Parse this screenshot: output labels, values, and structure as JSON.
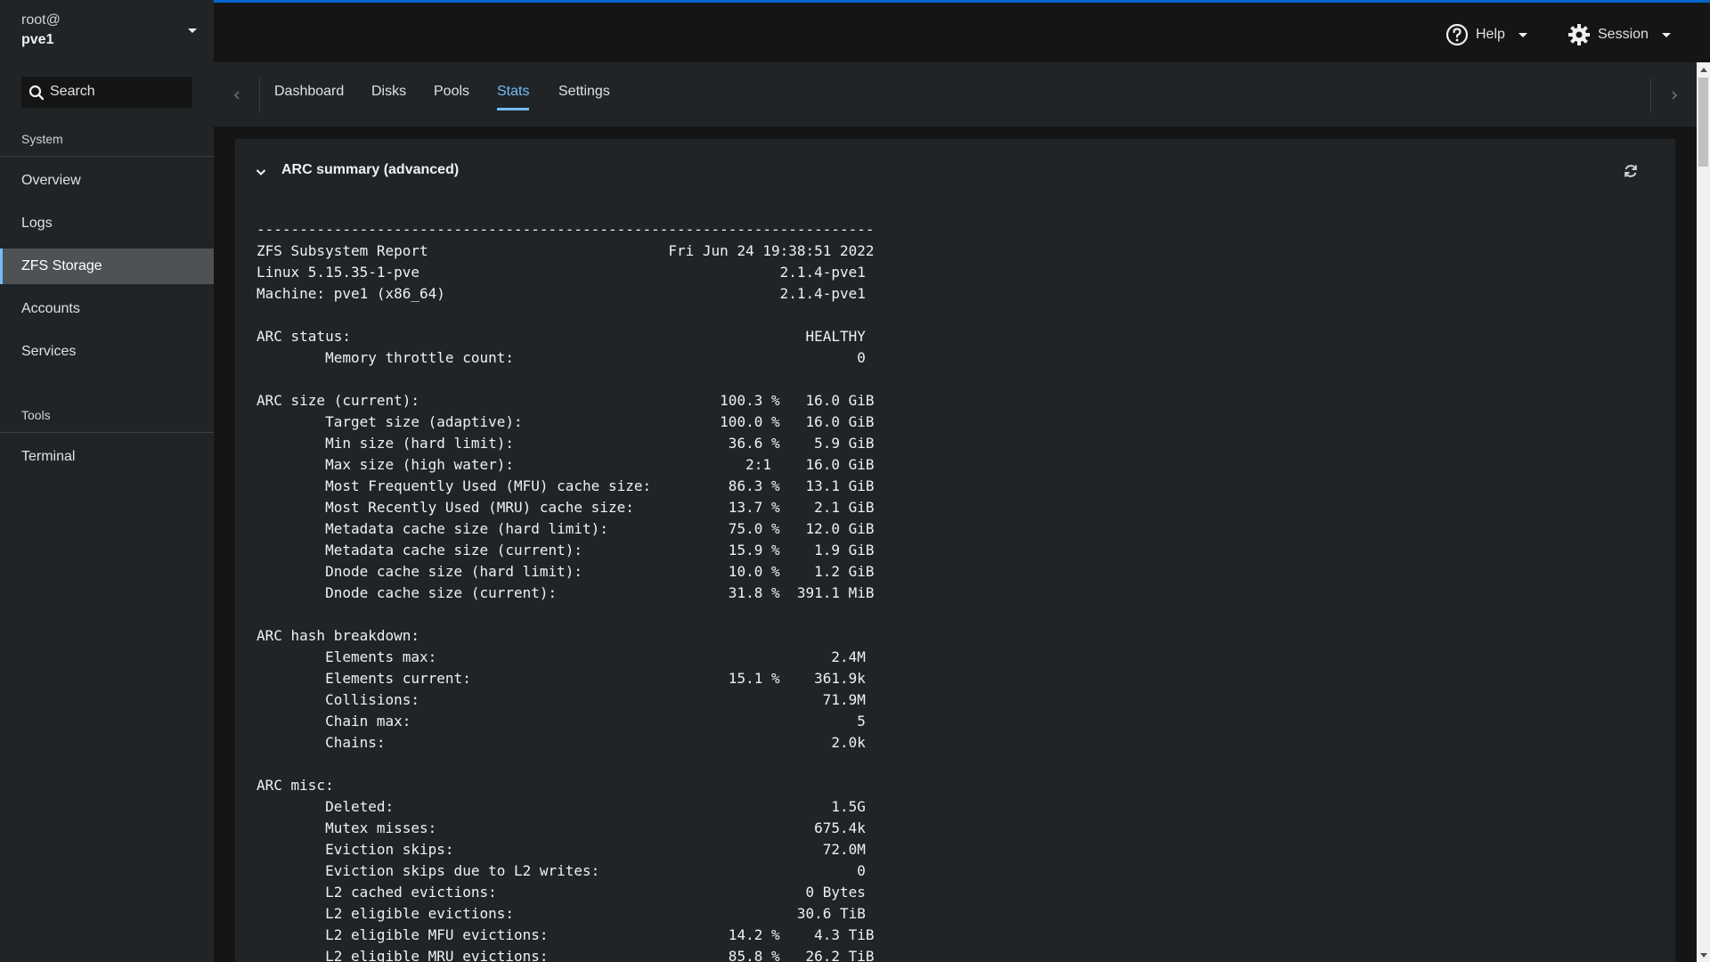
{
  "host": {
    "user": "root@",
    "name": "pve1"
  },
  "search": {
    "label": "Search"
  },
  "sidebar": {
    "system_label": "System",
    "tools_label": "Tools",
    "items": [
      {
        "label": "Overview"
      },
      {
        "label": "Logs"
      },
      {
        "label": "ZFS Storage",
        "active": true
      },
      {
        "label": "Accounts"
      },
      {
        "label": "Services"
      },
      {
        "label": "Terminal"
      }
    ]
  },
  "topbar": {
    "help_label": "Help",
    "session_label": "Session"
  },
  "tabs": [
    {
      "label": "Dashboard"
    },
    {
      "label": "Disks"
    },
    {
      "label": "Pools"
    },
    {
      "label": "Stats",
      "active": true
    },
    {
      "label": "Settings"
    }
  ],
  "card": {
    "title": "ARC summary (advanced)",
    "lines": [
      "------------------------------------------------------------------------",
      "ZFS Subsystem Report                            Fri Jun 24 19:38:51 2022",
      "Linux 5.15.35-1-pve                                          2.1.4-pve1",
      "Machine: pve1 (x86_64)                                       2.1.4-pve1",
      "",
      "ARC status:                                                     HEALTHY",
      "        Memory throttle count:                                        0",
      "",
      "ARC size (current):                                   100.3 %   16.0 GiB",
      "        Target size (adaptive):                       100.0 %   16.0 GiB",
      "        Min size (hard limit):                         36.6 %    5.9 GiB",
      "        Max size (high water):                           2:1    16.0 GiB",
      "        Most Frequently Used (MFU) cache size:         86.3 %   13.1 GiB",
      "        Most Recently Used (MRU) cache size:           13.7 %    2.1 GiB",
      "        Metadata cache size (hard limit):              75.0 %   12.0 GiB",
      "        Metadata cache size (current):                 15.9 %    1.9 GiB",
      "        Dnode cache size (hard limit):                 10.0 %    1.2 GiB",
      "        Dnode cache size (current):                    31.8 %  391.1 MiB",
      "",
      "ARC hash breakdown:",
      "        Elements max:                                              2.4M",
      "        Elements current:                              15.1 %    361.9k",
      "        Collisions:                                               71.9M",
      "        Chain max:                                                    5",
      "        Chains:                                                    2.0k",
      "",
      "ARC misc:",
      "        Deleted:                                                   1.5G",
      "        Mutex misses:                                            675.4k",
      "        Eviction skips:                                           72.0M",
      "        Eviction skips due to L2 writes:                              0",
      "        L2 cached evictions:                                    0 Bytes",
      "        L2 eligible evictions:                                 30.6 TiB",
      "        L2 eligible MFU evictions:                     14.2 %    4.3 TiB",
      "        L2 eligible MRU evictions:                     85.8 %   26.2 TiB"
    ]
  },
  "colors": {
    "accent": "#73bcf7",
    "brand_bar": "#0066cc",
    "sidebar_bg": "#212427",
    "page_bg": "#151515"
  }
}
